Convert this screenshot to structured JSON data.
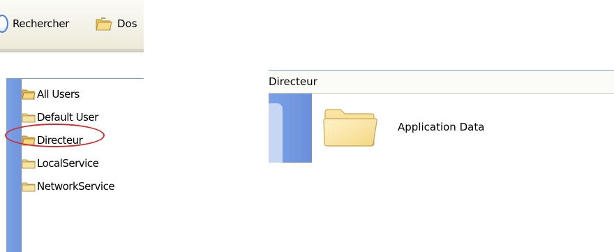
{
  "toolbar": {
    "search_label": "Rechercher",
    "folders_label": "Dos",
    "icons": {
      "search": "search-icon",
      "folders": "folders-icon"
    }
  },
  "tree": {
    "items": [
      {
        "label": "All Users",
        "icon": "folder-icon",
        "open": true
      },
      {
        "label": "Default User",
        "icon": "folder-icon",
        "open": false
      },
      {
        "label": "Directeur",
        "icon": "folder-icon",
        "open": true,
        "highlighted": true
      },
      {
        "label": "LocalService",
        "icon": "folder-icon",
        "open": false
      },
      {
        "label": "NetworkService",
        "icon": "folder-icon",
        "open": false
      }
    ]
  },
  "view": {
    "title": "Directeur",
    "items": [
      {
        "label": "Application Data",
        "icon": "folder-icon"
      }
    ]
  },
  "colors": {
    "highlight_ellipse": "#d42a2a",
    "taskpane_blue": "#7aa1e6",
    "folder_yellow": "#f5d57a"
  }
}
